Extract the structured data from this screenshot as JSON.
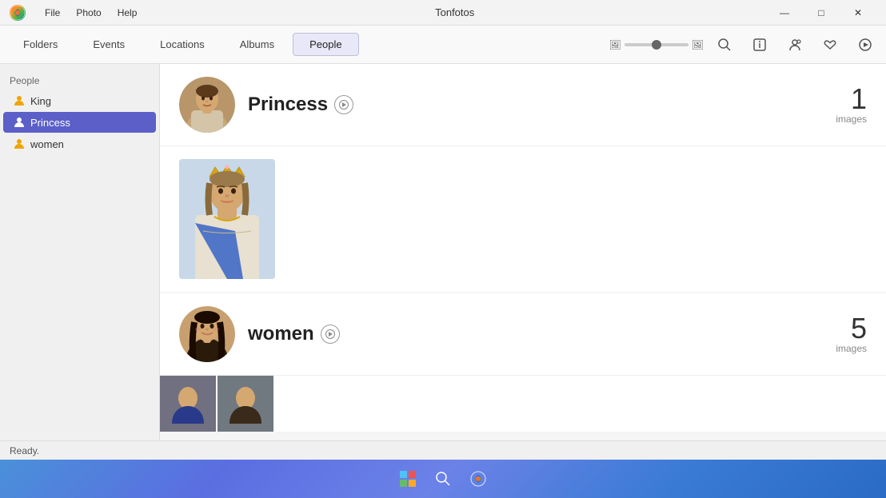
{
  "app": {
    "title": "Tonfotos",
    "icon": "🌐"
  },
  "titlebar": {
    "menu": [
      "File",
      "Photo",
      "Help"
    ],
    "minimize": "—",
    "maximize": "□",
    "close": "✕"
  },
  "toolbar": {
    "tabs": [
      "Folders",
      "Events",
      "Locations",
      "Albums",
      "People"
    ],
    "active_tab": "People",
    "zoom_label": "zoom-slider"
  },
  "toolbar_icons": {
    "search": "🔍",
    "info": "ℹ",
    "people": "👤",
    "heart": "♡",
    "play": "▷"
  },
  "sidebar": {
    "section_label": "People",
    "items": [
      {
        "id": "king",
        "label": "King",
        "active": false
      },
      {
        "id": "princess",
        "label": "Princess",
        "active": true
      },
      {
        "id": "women",
        "label": "women",
        "active": false
      }
    ]
  },
  "people": [
    {
      "id": "princess",
      "name": "Princess",
      "image_count": "1",
      "image_count_label": "images",
      "has_nav": true
    },
    {
      "id": "women",
      "name": "women",
      "image_count": "5",
      "image_count_label": "images",
      "has_nav": true
    }
  ],
  "status": {
    "text": "Ready."
  }
}
